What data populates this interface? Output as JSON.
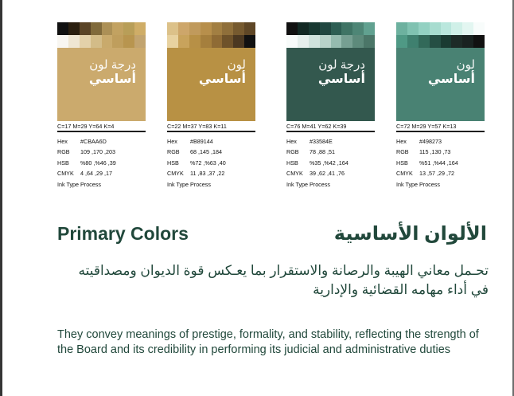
{
  "swatches": [
    {
      "title_line1": "درجة لون",
      "title_line2": "أساسي",
      "main_color": "#CBAA6D",
      "stripe_colors": [
        "#111111",
        "#2b1f0f",
        "#5a4426",
        "#806a3b",
        "#ac9056",
        "#c2a261",
        "#b89e58",
        "#cfad67",
        "#f8f6f1",
        "#efe6d2",
        "#e3d1aa",
        "#d3bc88",
        "#c9aa6c",
        "#bf9e5d",
        "#b8954f",
        "#c2a46f"
      ],
      "cmyk_title": "C=17 M=29 Y=64 K=4",
      "hex": "#CBAA6D",
      "rgb": "109 ,170 ,203",
      "hsb": "%80 ,%46 ,39",
      "cmyk": "4 ,64 ,29 ,17",
      "ink_type": "Process"
    },
    {
      "title_line1": "لون",
      "title_line2": "أساسي",
      "main_color": "#B89144",
      "stripe_colors": [
        "#dcc189",
        "#cda66a",
        "#c09a5c",
        "#b78f4b",
        "#a27f42",
        "#8f6f3a",
        "#765a2f",
        "#5f4726",
        "#e8d2a0",
        "#c8a35c",
        "#b79046",
        "#a57f3d",
        "#8f6b35",
        "#6e522a",
        "#4b3821",
        "#111111"
      ],
      "cmyk_title": "C=22 M=37 Y=83 K=11",
      "hex": "#B89144",
      "rgb": "68 ,145 ,184",
      "hsb": "%72 ,%63 ,40",
      "cmyk": "11 ,83 ,37 ,22",
      "ink_type": "Process"
    },
    {
      "title_line1": "درجة لون",
      "title_line2": "أساسي",
      "main_color": "#33584E",
      "stripe_colors": [
        "#111111",
        "#122823",
        "#183831",
        "#204740",
        "#2d5e53",
        "#3f7465",
        "#4e8676",
        "#61a190",
        "#f8fbfa",
        "#e6efec",
        "#cfe2dc",
        "#b7d2c9",
        "#95bbaf",
        "#769f92",
        "#5d8a7b",
        "#4b7668"
      ],
      "cmyk_title": "C=76 M=41 Y=62 K=39",
      "hex": "#33584E",
      "rgb": "78 ,88 ,51",
      "hsb": "%35 ,%42 ,164",
      "cmyk": "39 ,62 ,41 ,76",
      "ink_type": "Process"
    },
    {
      "title_line1": "لون",
      "title_line2": "أساسي",
      "main_color": "#498273",
      "stripe_colors": [
        "#6db19f",
        "#80c2b1",
        "#93d1c2",
        "#a7dccf",
        "#bae7dd",
        "#d0f0e8",
        "#e3f6f1",
        "#f8fcfb",
        "#4f9985",
        "#3f806f",
        "#326959",
        "#254f44",
        "#1a3b32",
        "#1d2b27",
        "#192220",
        "#111111"
      ],
      "cmyk_title": "C=72 M=29 Y=57 K=13",
      "hex": "#498273",
      "rgb": "115 ,130 ,73",
      "hsb": "%51 ,%44 ,164",
      "cmyk": "13 ,57 ,29 ,72",
      "ink_type": "Process"
    }
  ],
  "spec_labels": {
    "hex": "Hex",
    "rgb": "RGB",
    "hsb": "HSB",
    "cmyk": "CMYK",
    "ink_type": "Ink Type"
  },
  "headings": {
    "en": "Primary Colors",
    "ar": "الألوان الأساسية"
  },
  "description_ar": "تحـمل معاني الهيبة والرصانة والاستقرار بما يعـكس قوة الديوان ومصداقيته في أداء مهامه القضائية والإدارية",
  "description_en": "They convey meanings of prestige, formality, and stability, reflecting the strength of the Board and its credibility in performing its judicial and administrative duties"
}
